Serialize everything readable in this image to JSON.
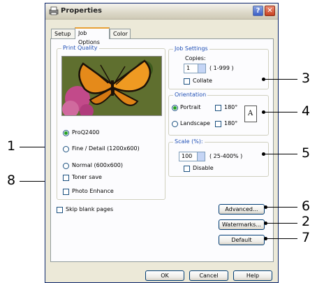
{
  "window": {
    "title": "Properties",
    "help_glyph": "?",
    "close_glyph": "✕"
  },
  "tabs": [
    {
      "label": "Setup"
    },
    {
      "label": "Job Options"
    },
    {
      "label": "Color"
    }
  ],
  "print_quality": {
    "title": "Print Quality",
    "options": [
      {
        "label": "ProQ2400",
        "selected": true
      },
      {
        "label": "Fine / Detail (1200x600)",
        "selected": false
      },
      {
        "label": "Normal (600x600)",
        "selected": false
      }
    ],
    "toner_save": "Toner save",
    "photo_enhance": "Photo Enhance"
  },
  "skip_blank": "Skip blank pages",
  "job_settings": {
    "title": "Job Settings",
    "copies_label": "Copies:",
    "copies_value": "1",
    "copies_range": "( 1-999 )",
    "collate": "Collate"
  },
  "orientation": {
    "title": "Orientation",
    "portrait": "Portrait",
    "landscape": "Landscape",
    "rot180": "180°",
    "preview_letter": "A"
  },
  "scale": {
    "title": "Scale (%):",
    "value": "100",
    "range": "( 25-400% )",
    "disable": "Disable"
  },
  "buttons": {
    "advanced": "Advanced...",
    "watermarks": "Watermarks...",
    "default": "Default",
    "ok": "OK",
    "cancel": "Cancel",
    "help": "Help"
  },
  "callouts": {
    "n1": "1",
    "n2": "2",
    "n3": "3",
    "n4": "4",
    "n5": "5",
    "n6": "6",
    "n7": "7",
    "n8": "8"
  },
  "colors": {
    "title_blue": "#1f4fb5",
    "radio_green": "#21a121",
    "dialog_bg": "#ece9d8"
  }
}
